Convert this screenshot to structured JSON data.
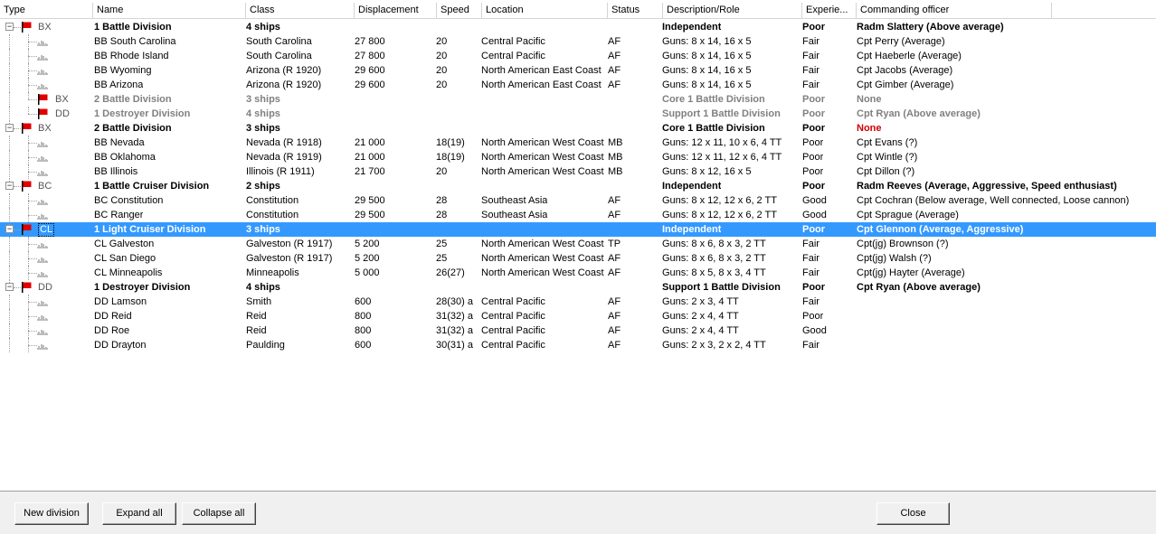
{
  "columns": {
    "type": "Type",
    "name": "Name",
    "class": "Class",
    "displacement": "Displacement",
    "speed": "Speed",
    "location": "Location",
    "status": "Status",
    "role": "Description/Role",
    "experience": "Experie...",
    "officer": "Commanding officer"
  },
  "colors": {
    "flag": "#e00000",
    "selection": "#3399ff",
    "warning": "#d40000",
    "muted": "#808080"
  },
  "rows": [
    {
      "kind": "group",
      "flag": true,
      "type": "BX",
      "name": "1 Battle Division",
      "class": "4 ships",
      "displacement": "",
      "speed": "",
      "location": "",
      "status": "",
      "role": "Independent",
      "experience": "Poor",
      "officer": "Radm Slattery (Above average)"
    },
    {
      "kind": "ship",
      "name": "BB South Carolina",
      "class": "South Carolina",
      "displacement": "27 800",
      "speed": "20",
      "location": "Central Pacific",
      "status": "AF",
      "role": "Guns: 8 x 14, 16 x 5",
      "experience": "Fair",
      "officer": "Cpt Perry (Average)"
    },
    {
      "kind": "ship",
      "name": "BB Rhode Island",
      "class": "South Carolina",
      "displacement": "27 800",
      "speed": "20",
      "location": "Central Pacific",
      "status": "AF",
      "role": "Guns: 8 x 14, 16 x 5",
      "experience": "Fair",
      "officer": "Cpt Haeberle (Average)"
    },
    {
      "kind": "ship",
      "name": "BB Wyoming",
      "class": "Arizona (R 1920)",
      "displacement": "29 600",
      "speed": "20",
      "location": "North American East Coast",
      "status": "AF",
      "role": "Guns: 8 x 14, 16 x 5",
      "experience": "Fair",
      "officer": "Cpt Jacobs (Average)"
    },
    {
      "kind": "ship",
      "name": "BB Arizona",
      "class": "Arizona (R 1920)",
      "displacement": "29 600",
      "speed": "20",
      "location": "North American East Coast",
      "status": "AF",
      "role": "Guns: 8 x 14, 16 x 5",
      "experience": "Fair",
      "officer": "Cpt Gimber (Average)"
    },
    {
      "kind": "subgroup",
      "flag": true,
      "type": "BX",
      "name": "2 Battle Division",
      "class": "3 ships",
      "displacement": "",
      "speed": "",
      "location": "",
      "status": "",
      "role": "Core 1 Battle Division",
      "experience": "Poor",
      "officer": "None"
    },
    {
      "kind": "subgroup",
      "flag": true,
      "type": "DD",
      "name": "1 Destroyer Division",
      "class": "4 ships",
      "displacement": "",
      "speed": "",
      "location": "",
      "status": "",
      "role": "Support 1 Battle Division",
      "experience": "Poor",
      "officer": "Cpt Ryan (Above average)"
    },
    {
      "kind": "group",
      "flag": true,
      "type": "BX",
      "name": "2 Battle Division",
      "class": "3 ships",
      "displacement": "",
      "speed": "",
      "location": "",
      "status": "",
      "role": "Core 1 Battle Division",
      "experience": "Poor",
      "officer": "None",
      "officer_warning": true
    },
    {
      "kind": "ship",
      "name": "BB Nevada",
      "class": "Nevada (R 1918)",
      "displacement": "21 000",
      "speed": "18(19)",
      "location": "North American West Coast",
      "status": "MB",
      "role": "Guns: 12 x 11, 10 x 6, 4 TT",
      "experience": "Poor",
      "officer": "Cpt Evans (?)"
    },
    {
      "kind": "ship",
      "name": "BB Oklahoma",
      "class": "Nevada (R 1919)",
      "displacement": "21 000",
      "speed": "18(19)",
      "location": "North American West Coast",
      "status": "MB",
      "role": "Guns: 12 x 11, 12 x 6, 4 TT",
      "experience": "Poor",
      "officer": "Cpt Wintle (?)"
    },
    {
      "kind": "ship",
      "name": "BB Illinois",
      "class": "Illinois (R 1911)",
      "displacement": "21 700",
      "speed": "20",
      "location": "North American West Coast",
      "status": "MB",
      "role": "Guns: 8 x 12, 16 x 5",
      "experience": "Poor",
      "officer": "Cpt Dillon (?)"
    },
    {
      "kind": "group",
      "flag": true,
      "type": "BC",
      "name": "1 Battle Cruiser Division",
      "class": "2 ships",
      "displacement": "",
      "speed": "",
      "location": "",
      "status": "",
      "role": "Independent",
      "experience": "Poor",
      "officer": "Radm Reeves (Average, Aggressive, Speed enthusiast)"
    },
    {
      "kind": "ship",
      "name": "BC Constitution",
      "class": "Constitution",
      "displacement": "29 500",
      "speed": "28",
      "location": "Southeast Asia",
      "status": "AF",
      "role": "Guns: 8 x 12, 12 x 6, 2 TT",
      "experience": "Good",
      "officer": "Cpt Cochran (Below average, Well connected, Loose cannon)"
    },
    {
      "kind": "ship",
      "name": "BC Ranger",
      "class": "Constitution",
      "displacement": "29 500",
      "speed": "28",
      "location": "Southeast Asia",
      "status": "AF",
      "role": "Guns: 8 x 12, 12 x 6, 2 TT",
      "experience": "Good",
      "officer": "Cpt Sprague (Average)"
    },
    {
      "kind": "group",
      "flag": true,
      "selected": true,
      "type": "CL",
      "name": "1 Light Cruiser Division",
      "class": "3 ships",
      "displacement": "",
      "speed": "",
      "location": "",
      "status": "",
      "role": "Independent",
      "experience": "Poor",
      "officer": "Cpt Glennon (Average, Aggressive)"
    },
    {
      "kind": "ship",
      "name": "CL Galveston",
      "class": "Galveston (R 1917)",
      "displacement": "5 200",
      "speed": "25",
      "location": "North American West Coast",
      "status": "TP",
      "role": "Guns: 8 x 6, 8 x 3, 2 TT",
      "experience": "Fair",
      "officer": "Cpt(jg) Brownson (?)"
    },
    {
      "kind": "ship",
      "name": "CL San Diego",
      "class": "Galveston (R 1917)",
      "displacement": "5 200",
      "speed": "25",
      "location": "North American West Coast",
      "status": "AF",
      "role": "Guns: 8 x 6, 8 x 3, 2 TT",
      "experience": "Fair",
      "officer": "Cpt(jg) Walsh (?)"
    },
    {
      "kind": "ship",
      "name": "CL Minneapolis",
      "class": "Minneapolis",
      "displacement": "5 000",
      "speed": "26(27)",
      "location": "North American West Coast",
      "status": "AF",
      "role": "Guns: 8 x 5, 8 x 3, 4 TT",
      "experience": "Fair",
      "officer": "Cpt(jg) Hayter (Average)"
    },
    {
      "kind": "group",
      "flag": true,
      "type": "DD",
      "name": "1 Destroyer Division",
      "class": "4 ships",
      "displacement": "",
      "speed": "",
      "location": "",
      "status": "",
      "role": "Support 1 Battle Division",
      "experience": "Poor",
      "officer": "Cpt Ryan (Above average)"
    },
    {
      "kind": "ship",
      "name": "DD Lamson",
      "class": "Smith",
      "displacement": "600",
      "speed": "28(30) a",
      "location": "Central Pacific",
      "status": "AF",
      "role": "Guns: 2 x 3, 4 TT",
      "experience": "Fair",
      "officer": ""
    },
    {
      "kind": "ship",
      "name": "DD Reid",
      "class": "Reid",
      "displacement": "800",
      "speed": "31(32) a",
      "location": "Central Pacific",
      "status": "AF",
      "role": "Guns: 2 x 4, 4 TT",
      "experience": "Poor",
      "officer": ""
    },
    {
      "kind": "ship",
      "name": "DD Roe",
      "class": "Reid",
      "displacement": "800",
      "speed": "31(32) a",
      "location": "Central Pacific",
      "status": "AF",
      "role": "Guns: 2 x 4, 4 TT",
      "experience": "Good",
      "officer": ""
    },
    {
      "kind": "ship",
      "name": "DD Drayton",
      "class": "Paulding",
      "displacement": "600",
      "speed": "30(31) a",
      "location": "Central Pacific",
      "status": "AF",
      "role": "Guns: 2 x 3, 2 x 2, 4 TT",
      "experience": "Fair",
      "officer": ""
    }
  ],
  "buttons": {
    "new_division": "New division",
    "expand_all": "Expand all",
    "collapse_all": "Collapse all",
    "close": "Close"
  }
}
